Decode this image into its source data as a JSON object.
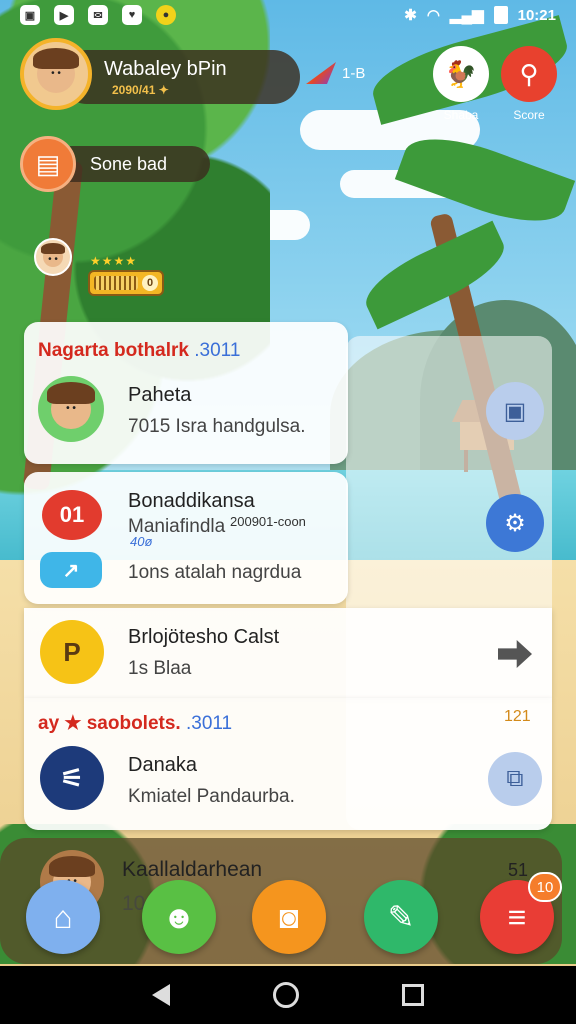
{
  "status_bar": {
    "left_icons": [
      "image-icon",
      "youtube-icon",
      "messenger-icon",
      "heart-icon",
      "circle-icon"
    ],
    "bluetooth": "✱",
    "time": "10:21"
  },
  "profile": {
    "name": "Wabaley bPin",
    "subtitle": "2090/41 ✦"
  },
  "scoreboard": {
    "label": "Sone bad"
  },
  "player_level": {
    "stars": "★★★★",
    "level_value": "0"
  },
  "header_logo": {
    "text": "1-B"
  },
  "corner_buttons": [
    {
      "label": "Shaba",
      "icon": "chicken-icon",
      "color": "#ffffff"
    },
    {
      "label": "Score",
      "icon": "pin-icon",
      "color": "#e8412e"
    }
  ],
  "card1": {
    "header": "Nagarta bothalrk",
    "header_accent": ".3011",
    "title": "Paheta",
    "subtitle": "7015 Isra handgulsa."
  },
  "card2": {
    "icon_text": "01",
    "title": "Bonaddikansa",
    "subtitle": "Maniafindla",
    "small_text": "200901-coon",
    "small_text_2": "40ø",
    "bottom_text": "1ons atalah nagrdua"
  },
  "card3": {
    "icon_text": "P",
    "title": "Brlojötesho Calst",
    "subtitle": "1s Blaa"
  },
  "card4": {
    "header": "ay ★ saobolets.",
    "header_prefix": "★",
    "header_accent": ".3011",
    "count": "121",
    "title": "Danaka",
    "subtitle": "Kmiatel Pandaurba."
  },
  "friend_bar": {
    "name": "Kaallaldarhean",
    "subtitle": "10",
    "count": "51"
  },
  "bottom_nav": [
    {
      "name": "home",
      "glyph": "⌂",
      "color": "#7fb0ee"
    },
    {
      "name": "profile",
      "glyph": "☻",
      "color": "#59c044"
    },
    {
      "name": "camera",
      "glyph": "◙",
      "color": "#f5951e"
    },
    {
      "name": "chat",
      "glyph": "✎",
      "color": "#2fb86a"
    },
    {
      "name": "menu",
      "glyph": "≡",
      "color": "#e93d35"
    }
  ],
  "nav_badge": "10"
}
